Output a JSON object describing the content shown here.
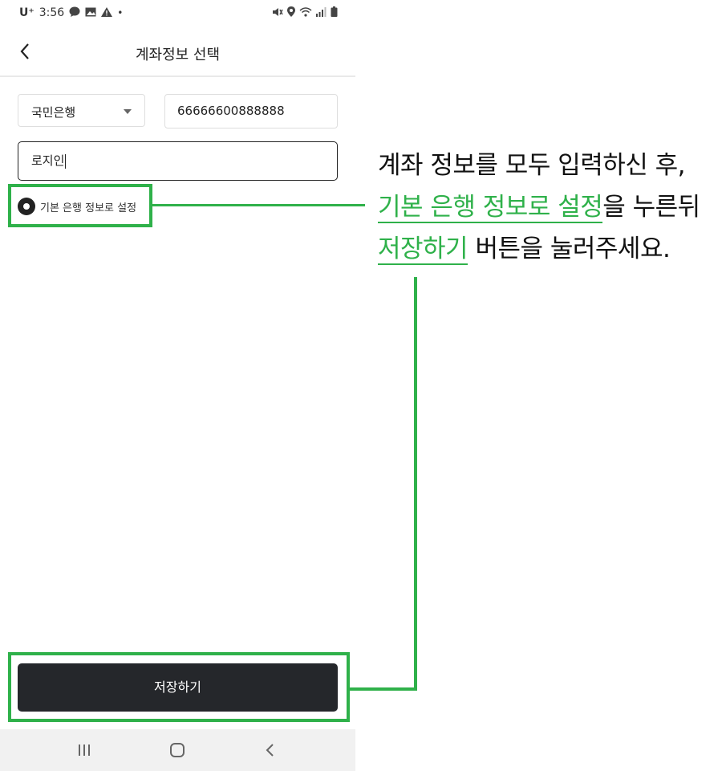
{
  "status_bar": {
    "carrier": "U⁺",
    "time": "3:56",
    "left_icons": [
      "talk-icon",
      "gallery-icon",
      "warning-icon",
      "dot-icon"
    ],
    "right_icons": [
      "mute-icon",
      "location-icon",
      "wifi-icon",
      "signal-icon",
      "battery-icon"
    ]
  },
  "header": {
    "title": "계좌정보 선택",
    "back_icon": "chevron-left-icon"
  },
  "form": {
    "bank": "국민은행",
    "account_number": "66666600888888",
    "holder_name": "로지인",
    "default_bank_label": "기본 은행 정보로 설정",
    "default_bank_checked": true
  },
  "save_button": {
    "label": "저장하기"
  },
  "nav_bar": {
    "items": [
      "recent-apps-icon",
      "home-icon",
      "back-icon"
    ]
  },
  "annotation": {
    "line1": "계좌 정보를 모두 입력하신 후,",
    "line2_highlight": "기본 은행 정보로 설정",
    "line2_rest": "을 누른뒤",
    "line3_highlight": "저장하기",
    "line3_rest": " 버튼을 눌러주세요.",
    "accent_color": "#2fb14a"
  }
}
